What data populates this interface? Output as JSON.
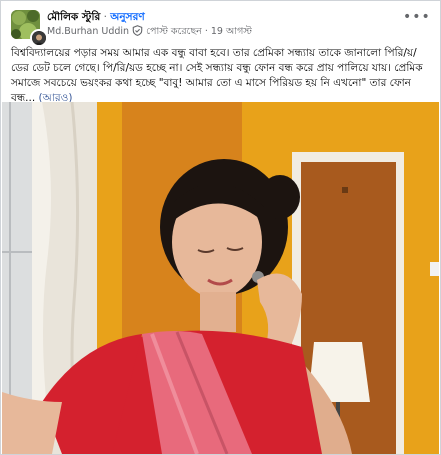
{
  "post": {
    "group_name": "মৌলিক স্টুরি",
    "separator": "·",
    "follow_label": "অনুসরণ",
    "author_name": "Md.Burhan Uddin",
    "action_text": "পোস্ট করেছেন",
    "dot": "·",
    "date": "19 আগস্ট",
    "more_label": "•••",
    "text": "বিশ্ববিদ্যালয়ের পড়ার সময় আমার এক বন্ধু বাবা হবে। তার প্রেমিকা সন্ধ্যায় তাকে জানালো পিরি/য়/ডের ডেট চলে গেছে। পি/রি/য়ড হচ্ছে না। সেই সন্ধ্যায় বন্ধু ফোন বন্ধ করে প্রায় পালিয়ে যায়। প্রেমিক সমাজে সবচেয়ে ভয়ংকর কথা হচ্ছে \"বাবু! আমার তো এ মাসে পিরিয়ড হয় নি এখনো\" তার ফোন বন্ধ...",
    "see_more": "(আরও)"
  },
  "icons": {
    "group_avatar": "group-avatar",
    "user_avatar": "user-avatar",
    "shield": "shield-icon"
  },
  "colors": {
    "link": "#0866ff",
    "secondary_text": "#65676b",
    "wall": "#e8a21a",
    "door": "#a85a1e",
    "saree": "#e86a7c",
    "blouse": "#d4212e"
  }
}
